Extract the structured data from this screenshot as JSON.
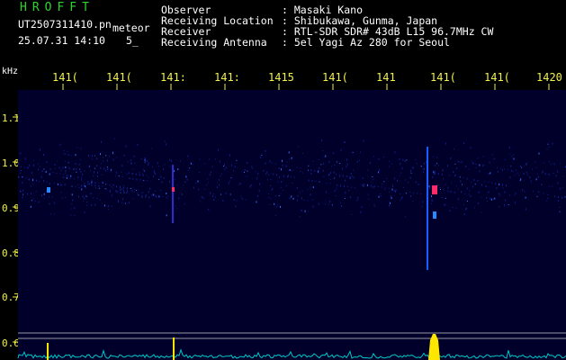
{
  "header": {
    "logo": "HROFFT",
    "filename": "UT2507311410.pn",
    "label": "meteor",
    "datetime": "25.07.31 14:10",
    "count": "5_",
    "info": [
      {
        "label": "Observer",
        "value": ": Masaki Kano"
      },
      {
        "label": "Receiving Location",
        "value": ": Shibukawa, Gunma, Japan"
      },
      {
        "label": "Receiver",
        "value": ": RTL-SDR SDR# 43dB L15 96.7MHz CW"
      },
      {
        "label": "Receiving Antenna",
        "value": ": 5el Yagi Az 280 for Seoul"
      }
    ]
  },
  "axis": {
    "unit": "kHz",
    "x_ticks": [
      "141(",
      "141(",
      "141:",
      "141:",
      "1415",
      "141(",
      "141",
      "141(",
      "141(",
      "1420"
    ],
    "y_ticks": [
      "1.1",
      "1.0",
      "0.9",
      "0.8",
      "0.7",
      "0.6"
    ]
  },
  "colors": {
    "background": "#000000",
    "plot_background": "#00002a",
    "logo": "#2bd62b",
    "axis_labels": "#f2f24a",
    "text": "#ffffff",
    "signal": "#1a5cff",
    "hot": "#ff2a6a",
    "spectrum": "#00c8c8",
    "spike": "#ffe600"
  }
}
